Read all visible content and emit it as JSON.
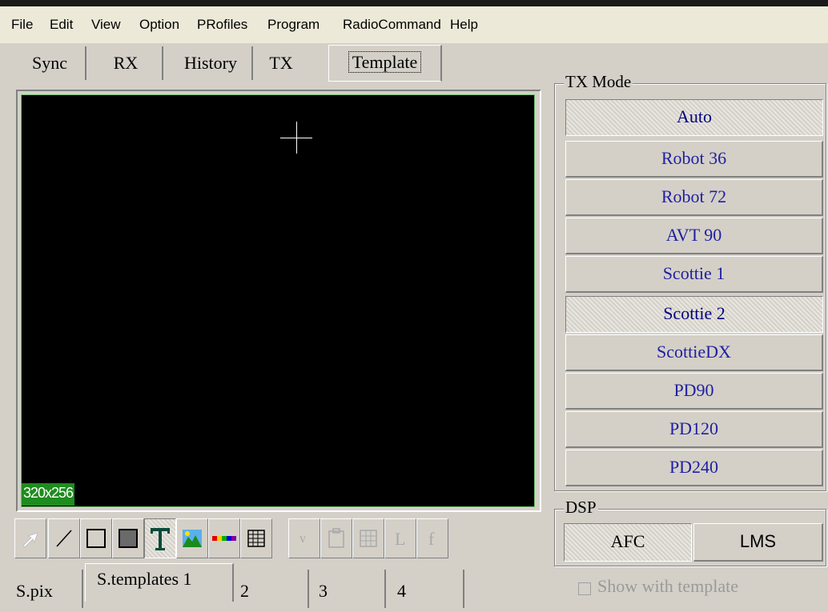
{
  "menu": [
    "File",
    "Edit",
    "View",
    "Option",
    "PRofiles",
    "Program",
    "RadioCommand",
    "Help"
  ],
  "tabs": {
    "sync": "Sync",
    "rx": "RX",
    "history": "History",
    "tx": "TX",
    "template": "Template"
  },
  "canvas": {
    "dimension_label": "320x256"
  },
  "tx_mode": {
    "title": "TX Mode",
    "modes": [
      "Auto",
      "Robot 36",
      "Robot 72",
      "AVT 90",
      "Scottie 1",
      "Scottie 2",
      "ScottieDX",
      "PD90",
      "PD120",
      "PD240"
    ],
    "selected": [
      "Auto",
      "Scottie 2"
    ]
  },
  "dsp": {
    "title": "DSP",
    "afc": "AFC",
    "lms": "LMS"
  },
  "show_with_template": "Show with template",
  "bottom_tabs": [
    "S.pix",
    "S.templates 1",
    "2",
    "3",
    "4"
  ],
  "toolbar_icons": [
    "pointer-icon",
    "line-icon",
    "rectangle-icon",
    "filled-rectangle-icon",
    "text-icon",
    "image-icon",
    "color-bar-icon",
    "grid-icon",
    "v-icon",
    "paste-icon",
    "table-icon",
    "l-icon",
    "f-icon"
  ],
  "colors": {
    "accent_text": "#2020a0",
    "canvas_bg": "#000000",
    "dim_label_bg": "#1e8c1e"
  }
}
